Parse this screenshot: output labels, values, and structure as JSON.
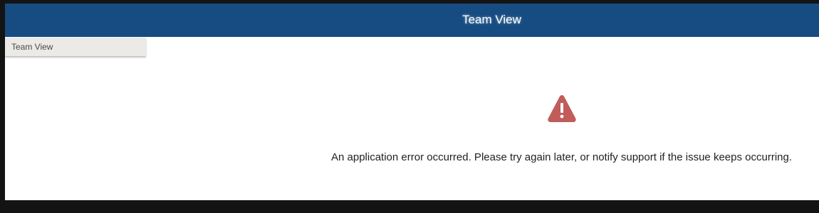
{
  "header": {
    "title": "Team View"
  },
  "sidebar": {
    "items": [
      {
        "label": "Team View"
      }
    ]
  },
  "error": {
    "icon": "warning-icon",
    "icon_color": "#c05c5a",
    "message": "An application error occurred. Please try again later, or notify support if the issue keeps occurring."
  },
  "colors": {
    "header_bg": "#174c82",
    "sidebar_item_bg": "#ebeae6"
  }
}
